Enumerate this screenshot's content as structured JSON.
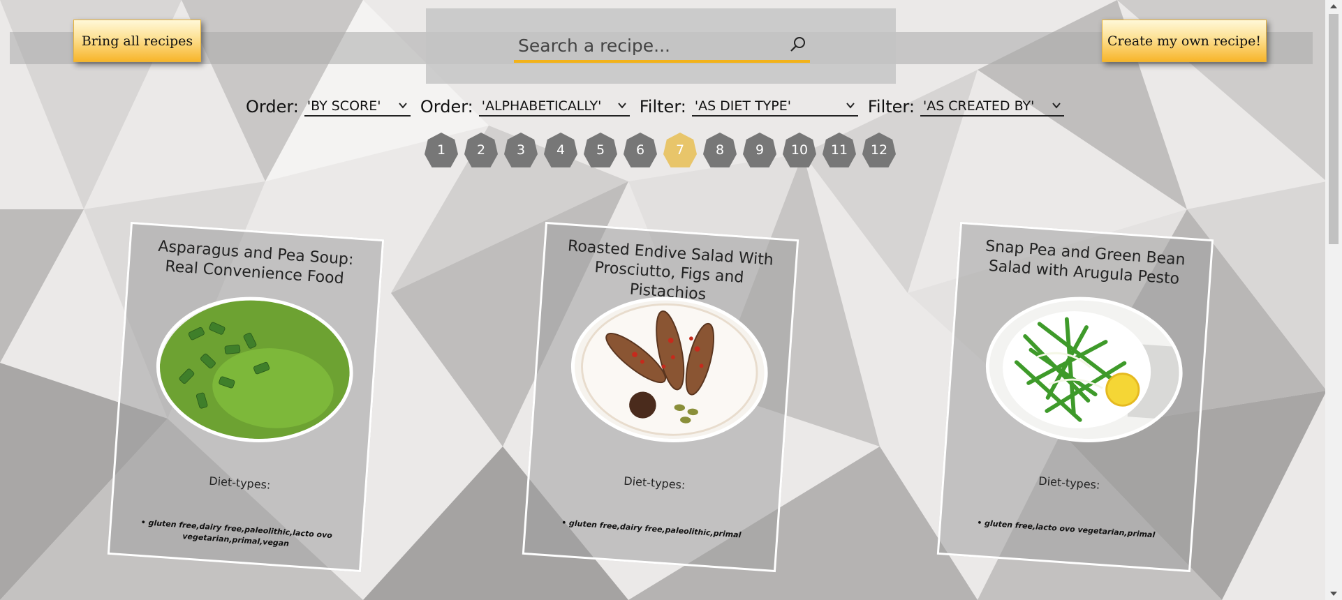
{
  "header": {
    "bring_all_label": "Bring all recipes",
    "create_label": "Create my own recipe!"
  },
  "search": {
    "placeholder": "Search a recipe...",
    "value": ""
  },
  "filters": [
    {
      "label": "Order:",
      "value": "'BY SCORE'"
    },
    {
      "label": "Order:",
      "value": "'ALPHABETICALLY'"
    },
    {
      "label": "Filter:",
      "value": "'AS DIET TYPE'"
    },
    {
      "label": "Filter:",
      "value": "'AS CREATED BY'"
    }
  ],
  "pagination": {
    "pages": [
      "1",
      "2",
      "3",
      "4",
      "5",
      "6",
      "7",
      "8",
      "9",
      "10",
      "11",
      "12"
    ],
    "current": "7"
  },
  "recipes": [
    {
      "title": "Asparagus and Pea Soup: Real Convenience Food",
      "diet_label": "Diet-types:",
      "diets": "• gluten free,dairy free,paleolithic,lacto ovo vegetarian,primal,vegan"
    },
    {
      "title": "Roasted Endive Salad With Prosciutto, Figs and Pistachios",
      "diet_label": "Diet-types:",
      "diets": "• gluten free,dairy free,paleolithic,primal"
    },
    {
      "title": "Snap Pea and Green Bean Salad with Arugula Pesto",
      "diet_label": "Diet-types:",
      "diets": "• gluten free,lacto ovo vegetarian,primal"
    }
  ],
  "icons": {
    "search": "search-icon",
    "dropdown": "chevron-down-icon"
  },
  "colors": {
    "accent": "#f2b21a",
    "active_page": "#e8c56a",
    "page": "#777777"
  }
}
